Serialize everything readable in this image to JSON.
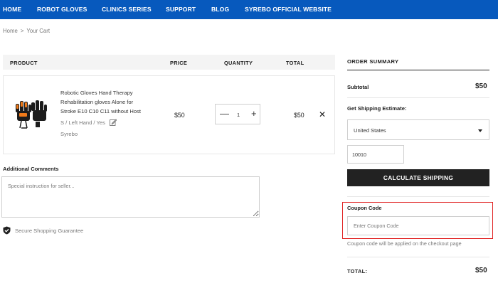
{
  "nav": {
    "items": [
      "HOME",
      "ROBOT GLOVES",
      "CLINICS SERIES",
      "SUPPORT",
      "BLOG",
      "SYREBO OFFICIAL WEBSITE"
    ],
    "bg_color": "#0759bd"
  },
  "breadcrumb": {
    "home": "Home",
    "separator": ">",
    "current": "Your Cart"
  },
  "cart": {
    "headers": {
      "product": "PRODUCT",
      "price": "PRICE",
      "quantity": "QUANTITY",
      "total": "TOTAL"
    },
    "item": {
      "title": "Robotic Gloves Hand Therapy Rehabilitation gloves Alone for Stroke E10 C10 C11 without Host",
      "variant": "S / Left Hand / Yes",
      "vendor": "Syrebo",
      "price": "$50",
      "quantity": "1",
      "line_total": "$50",
      "minus_symbol": "—",
      "plus_symbol": "+",
      "remove_symbol": "✕",
      "image_icon": "robotic-glove-product-image",
      "edit_icon": "edit-pencil-icon"
    }
  },
  "comments": {
    "label": "Additional Comments",
    "placeholder": "Special instruction for seller..."
  },
  "guarantee": {
    "text": "Secure Shopping Guarantee",
    "icon": "shield-check-icon"
  },
  "summary": {
    "title": "ORDER SUMMARY",
    "subtotal_label": "Subtotal",
    "subtotal_value": "$50",
    "shipping_label": "Get Shipping Estimate:",
    "country": "United States",
    "zip": "10010",
    "calculate_label": "CALCULATE SHIPPING",
    "coupon_label": "Coupon Code",
    "coupon_placeholder": "Enter Coupon Code",
    "coupon_note": "Coupon code will be applied on the checkout page",
    "total_label": "TOTAL:",
    "total_value": "$50",
    "highlight_color": "#e02020"
  }
}
